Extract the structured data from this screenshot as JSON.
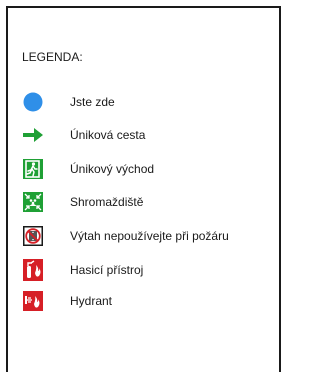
{
  "legend": {
    "title": "LEGENDA:",
    "items": [
      {
        "icon": "you-are-here-dot-icon",
        "label": "Jste zde",
        "color": "#2f8fe8"
      },
      {
        "icon": "escape-route-arrow-icon",
        "label": "Úniková cesta",
        "color": "#1fa035"
      },
      {
        "icon": "emergency-exit-icon",
        "label": "Únikový východ",
        "color": "#1fa035"
      },
      {
        "icon": "assembly-point-icon",
        "label": "Shromaždiště",
        "color": "#1fa035"
      },
      {
        "icon": "no-elevator-icon",
        "label": "Výtah nepoužívejte při požáru",
        "color": "#d61f26"
      },
      {
        "icon": "fire-extinguisher-icon",
        "label": "Hasicí přístroj",
        "color": "#d61f26"
      },
      {
        "icon": "fire-hydrant-icon",
        "label": "Hydrant",
        "color": "#d61f26"
      }
    ]
  }
}
